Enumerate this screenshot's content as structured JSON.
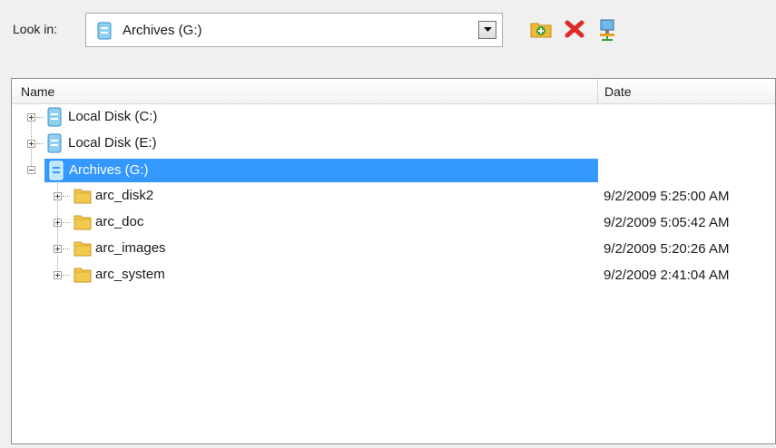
{
  "toolbar": {
    "look_in_label": "Look in:",
    "look_in_value": "Archives (G:)",
    "buttons": [
      "new-folder-icon",
      "delete-icon",
      "network-icon"
    ]
  },
  "columns": {
    "name": "Name",
    "date": "Date"
  },
  "tree": [
    {
      "label": "Local Disk (C:)",
      "type": "drive",
      "expanded": false,
      "date": ""
    },
    {
      "label": "Local Disk (E:)",
      "type": "drive",
      "expanded": false,
      "date": ""
    },
    {
      "label": "Archives (G:)",
      "type": "drive",
      "expanded": true,
      "selected": true,
      "date": ""
    },
    {
      "label": "arc_disk2",
      "type": "folder",
      "expanded": false,
      "date": "9/2/2009 5:25:00 AM"
    },
    {
      "label": "arc_doc",
      "type": "folder",
      "expanded": false,
      "date": "9/2/2009 5:05:42 AM"
    },
    {
      "label": "arc_images",
      "type": "folder",
      "expanded": false,
      "date": "9/2/2009 5:20:26 AM"
    },
    {
      "label": "arc_system",
      "type": "folder",
      "expanded": false,
      "date": "9/2/2009 2:41:04 AM"
    }
  ],
  "colors": {
    "selection": "#3399ff",
    "folder": "#f2c94c"
  }
}
